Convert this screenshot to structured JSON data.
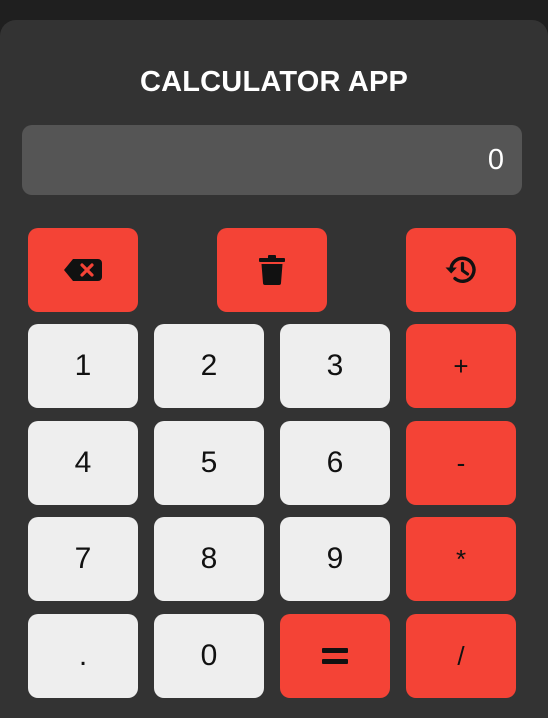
{
  "app": {
    "title": "CALCULATOR APP"
  },
  "display": {
    "value": "0"
  },
  "icons": {
    "backspace": "backspace-icon",
    "clear": "trash-icon",
    "history": "history-icon",
    "equals": "equals-icon"
  },
  "keys": {
    "one": "1",
    "two": "2",
    "three": "3",
    "plus": "+",
    "four": "4",
    "five": "5",
    "six": "6",
    "minus": "-",
    "seven": "7",
    "eight": "8",
    "nine": "9",
    "multiply": "*",
    "dot": ".",
    "zero": "0",
    "divide": "/"
  },
  "colors": {
    "background": "#333333",
    "display": "#555555",
    "accent": "#f44336",
    "number_key": "#eeeeee",
    "text_light": "#ffffff",
    "text_dark": "#111111"
  }
}
